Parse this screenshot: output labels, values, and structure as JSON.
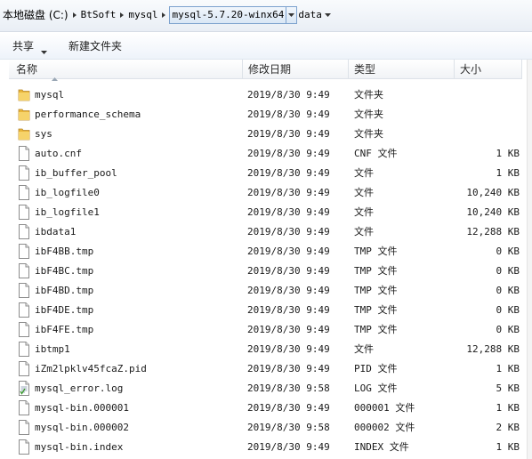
{
  "breadcrumb": {
    "root": "本地磁盘 (C:)",
    "items": [
      "BtSoft",
      "mysql",
      "mysql-5.7.20-winx64",
      "data"
    ]
  },
  "toolbar": {
    "share_label": "共享",
    "new_folder_label": "新建文件夹"
  },
  "columns": {
    "name": "名称",
    "date": "修改日期",
    "type": "类型",
    "size": "大小"
  },
  "files": [
    {
      "name": "mysql",
      "date": "2019/8/30 9:49",
      "type": "文件夹",
      "size": "",
      "icon": "folder-icon"
    },
    {
      "name": "performance_schema",
      "date": "2019/8/30 9:49",
      "type": "文件夹",
      "size": "",
      "icon": "folder-icon"
    },
    {
      "name": "sys",
      "date": "2019/8/30 9:49",
      "type": "文件夹",
      "size": "",
      "icon": "folder-icon"
    },
    {
      "name": "auto.cnf",
      "date": "2019/8/30 9:49",
      "type": "CNF 文件",
      "size": "1 KB",
      "icon": "file-icon"
    },
    {
      "name": "ib_buffer_pool",
      "date": "2019/8/30 9:49",
      "type": "文件",
      "size": "1 KB",
      "icon": "file-icon"
    },
    {
      "name": "ib_logfile0",
      "date": "2019/8/30 9:49",
      "type": "文件",
      "size": "10,240 KB",
      "icon": "file-icon"
    },
    {
      "name": "ib_logfile1",
      "date": "2019/8/30 9:49",
      "type": "文件",
      "size": "10,240 KB",
      "icon": "file-icon"
    },
    {
      "name": "ibdata1",
      "date": "2019/8/30 9:49",
      "type": "文件",
      "size": "12,288 KB",
      "icon": "file-icon"
    },
    {
      "name": "ibF4BB.tmp",
      "date": "2019/8/30 9:49",
      "type": "TMP 文件",
      "size": "0 KB",
      "icon": "file-icon"
    },
    {
      "name": "ibF4BC.tmp",
      "date": "2019/8/30 9:49",
      "type": "TMP 文件",
      "size": "0 KB",
      "icon": "file-icon"
    },
    {
      "name": "ibF4BD.tmp",
      "date": "2019/8/30 9:49",
      "type": "TMP 文件",
      "size": "0 KB",
      "icon": "file-icon"
    },
    {
      "name": "ibF4DE.tmp",
      "date": "2019/8/30 9:49",
      "type": "TMP 文件",
      "size": "0 KB",
      "icon": "file-icon"
    },
    {
      "name": "ibF4FE.tmp",
      "date": "2019/8/30 9:49",
      "type": "TMP 文件",
      "size": "0 KB",
      "icon": "file-icon"
    },
    {
      "name": "ibtmp1",
      "date": "2019/8/30 9:49",
      "type": "文件",
      "size": "12,288 KB",
      "icon": "file-icon"
    },
    {
      "name": "iZm2lpklv45fcaZ.pid",
      "date": "2019/8/30 9:49",
      "type": "PID 文件",
      "size": "1 KB",
      "icon": "file-icon"
    },
    {
      "name": "mysql_error.log",
      "date": "2019/8/30 9:58",
      "type": "LOG 文件",
      "size": "5 KB",
      "icon": "text-file-icon"
    },
    {
      "name": "mysql-bin.000001",
      "date": "2019/8/30 9:49",
      "type": "000001 文件",
      "size": "1 KB",
      "icon": "file-icon"
    },
    {
      "name": "mysql-bin.000002",
      "date": "2019/8/30 9:58",
      "type": "000002 文件",
      "size": "2 KB",
      "icon": "file-icon"
    },
    {
      "name": "mysql-bin.index",
      "date": "2019/8/30 9:49",
      "type": "INDEX 文件",
      "size": "1 KB",
      "icon": "file-icon"
    }
  ]
}
